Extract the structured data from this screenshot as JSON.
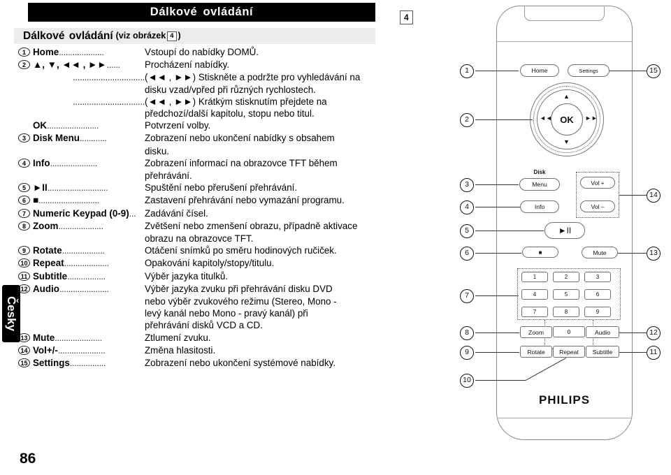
{
  "language_tab": {
    "label": "Česky"
  },
  "header": {
    "banner_title": "Dálkové ovládání"
  },
  "subtitle": {
    "main": "Dálkové ovládání",
    "paren_open": "(viz obrázek",
    "figure_ref": "4",
    "paren_close": ")"
  },
  "figure_marker": {
    "number": "4"
  },
  "page_number": "86",
  "leaders": {
    "dots_long": "..........................",
    "dots_med": "....................",
    "dots_short": "...............",
    "dots_tiny": "......"
  },
  "spec_list": [
    {
      "num": "1",
      "label": "Home",
      "leader": "....................",
      "desc": "Vstoupí do nabídky DOMŮ.",
      "continuations": []
    },
    {
      "num": "2",
      "label": "▲, ▼, ◄◄ , ►►",
      "leader": "......",
      "desc": "Procházení nabídky.",
      "continuations": [
        {
          "leader": "...............................",
          "desc": "(◄◄ , ►►) Stiskněte a podržte pro vyhledávání na"
        },
        {
          "leader": "",
          "desc": "disku vzad/vpřed při různých rychlostech."
        },
        {
          "leader": "...............................",
          "desc": "(◄◄ , ►►) Krátkým stisknutím přejdete na"
        },
        {
          "leader": "",
          "desc": "předchozí/další kapitolu, stopu nebo titul."
        }
      ]
    },
    {
      "num": "",
      "label": "OK",
      "leader": ".......................",
      "desc": "Potvrzení volby.",
      "continuations": []
    },
    {
      "num": "3",
      "label": "Disk Menu",
      "leader": "............",
      "desc": "Zobrazení nebo ukončení nabídky s obsahem",
      "continuations": [
        {
          "leader": "",
          "desc": "disku."
        }
      ]
    },
    {
      "num": "4",
      "label": "Info",
      "leader": ".....................",
      "desc": "Zobrazení informací na obrazovce TFT během",
      "continuations": [
        {
          "leader": "",
          "desc": "přehrávání."
        }
      ]
    },
    {
      "num": "5",
      "label": "►II",
      "leader": "...........................",
      "desc": "Spuštění nebo přerušení přehrávání.",
      "continuations": []
    },
    {
      "num": "6",
      "label": "■",
      "leader": "...........................",
      "desc": "Zastavení přehrávání nebo vymazání programu.",
      "continuations": []
    },
    {
      "num": "7",
      "label": "Numeric Keypad (0-9)",
      "leader": "...",
      "desc": "Zadávání čísel.",
      "continuations": []
    },
    {
      "num": "8",
      "label": "Zoom",
      "leader": "....................",
      "desc": "Zvětšení nebo zmenšení obrazu, případně aktivace",
      "continuations": [
        {
          "leader": "",
          "desc": "obrazu na obrazovce TFT."
        }
      ]
    },
    {
      "num": "9",
      "label": "Rotate",
      "leader": "...................",
      "desc": "Otáčení snímků po směru hodinových ručiček.",
      "continuations": []
    },
    {
      "num": "10",
      "label": "Repeat",
      "leader": "....................",
      "desc": "Opakování kapitoly/stopy/titulu.",
      "continuations": []
    },
    {
      "num": "11",
      "label": "Subtitle",
      "leader": ".................",
      "desc": "Výběr jazyka titulků.",
      "continuations": []
    },
    {
      "num": "12",
      "label": "Audio",
      "leader": "......................",
      "desc": "Výběr jazyka zvuku při přehrávání disku DVD",
      "continuations": [
        {
          "leader": "",
          "desc": "nebo výběr zvukového režimu (Stereo, Mono -"
        },
        {
          "leader": "",
          "desc": "levý kanál nebo Mono - pravý kanál) při"
        },
        {
          "leader": "",
          "desc": "přehrávání disků VCD a CD."
        }
      ]
    },
    {
      "num": "13",
      "label": "Mute",
      "leader": ".....................",
      "desc": "Ztlumení zvuku.",
      "continuations": []
    },
    {
      "num": "14",
      "label": "Vol+/-",
      "leader": ".....................",
      "desc": "Změna hlasitosti.",
      "continuations": []
    },
    {
      "num": "15",
      "label": "Settings",
      "leader": "................",
      "desc": "Zobrazení nebo ukončení systémové nabídky.",
      "continuations": []
    }
  ],
  "remote": {
    "brand": "PHILIPS",
    "buttons": {
      "home": "Home",
      "settings": "Settings",
      "disk_label": "Disk",
      "menu": "Menu",
      "info": "Info",
      "vol_plus": "Vol +",
      "vol_minus": "Vol –",
      "play_pause": "►II",
      "stop": "■",
      "mute": "Mute",
      "ok": "OK",
      "zoom": "Zoom",
      "zero": "0",
      "audio": "Audio",
      "rotate": "Rotate",
      "repeat": "Repeat",
      "subtitle": "Subtitle"
    },
    "nav_arrows": {
      "up": "▲",
      "down": "▼",
      "left": "◄◄",
      "right": "►►"
    },
    "numeric_keys": [
      "1",
      "2",
      "3",
      "4",
      "5",
      "6",
      "7",
      "8",
      "9"
    ],
    "callouts": [
      "1",
      "2",
      "3",
      "4",
      "5",
      "6",
      "7",
      "8",
      "9",
      "10",
      "11",
      "12",
      "13",
      "14",
      "15"
    ]
  }
}
